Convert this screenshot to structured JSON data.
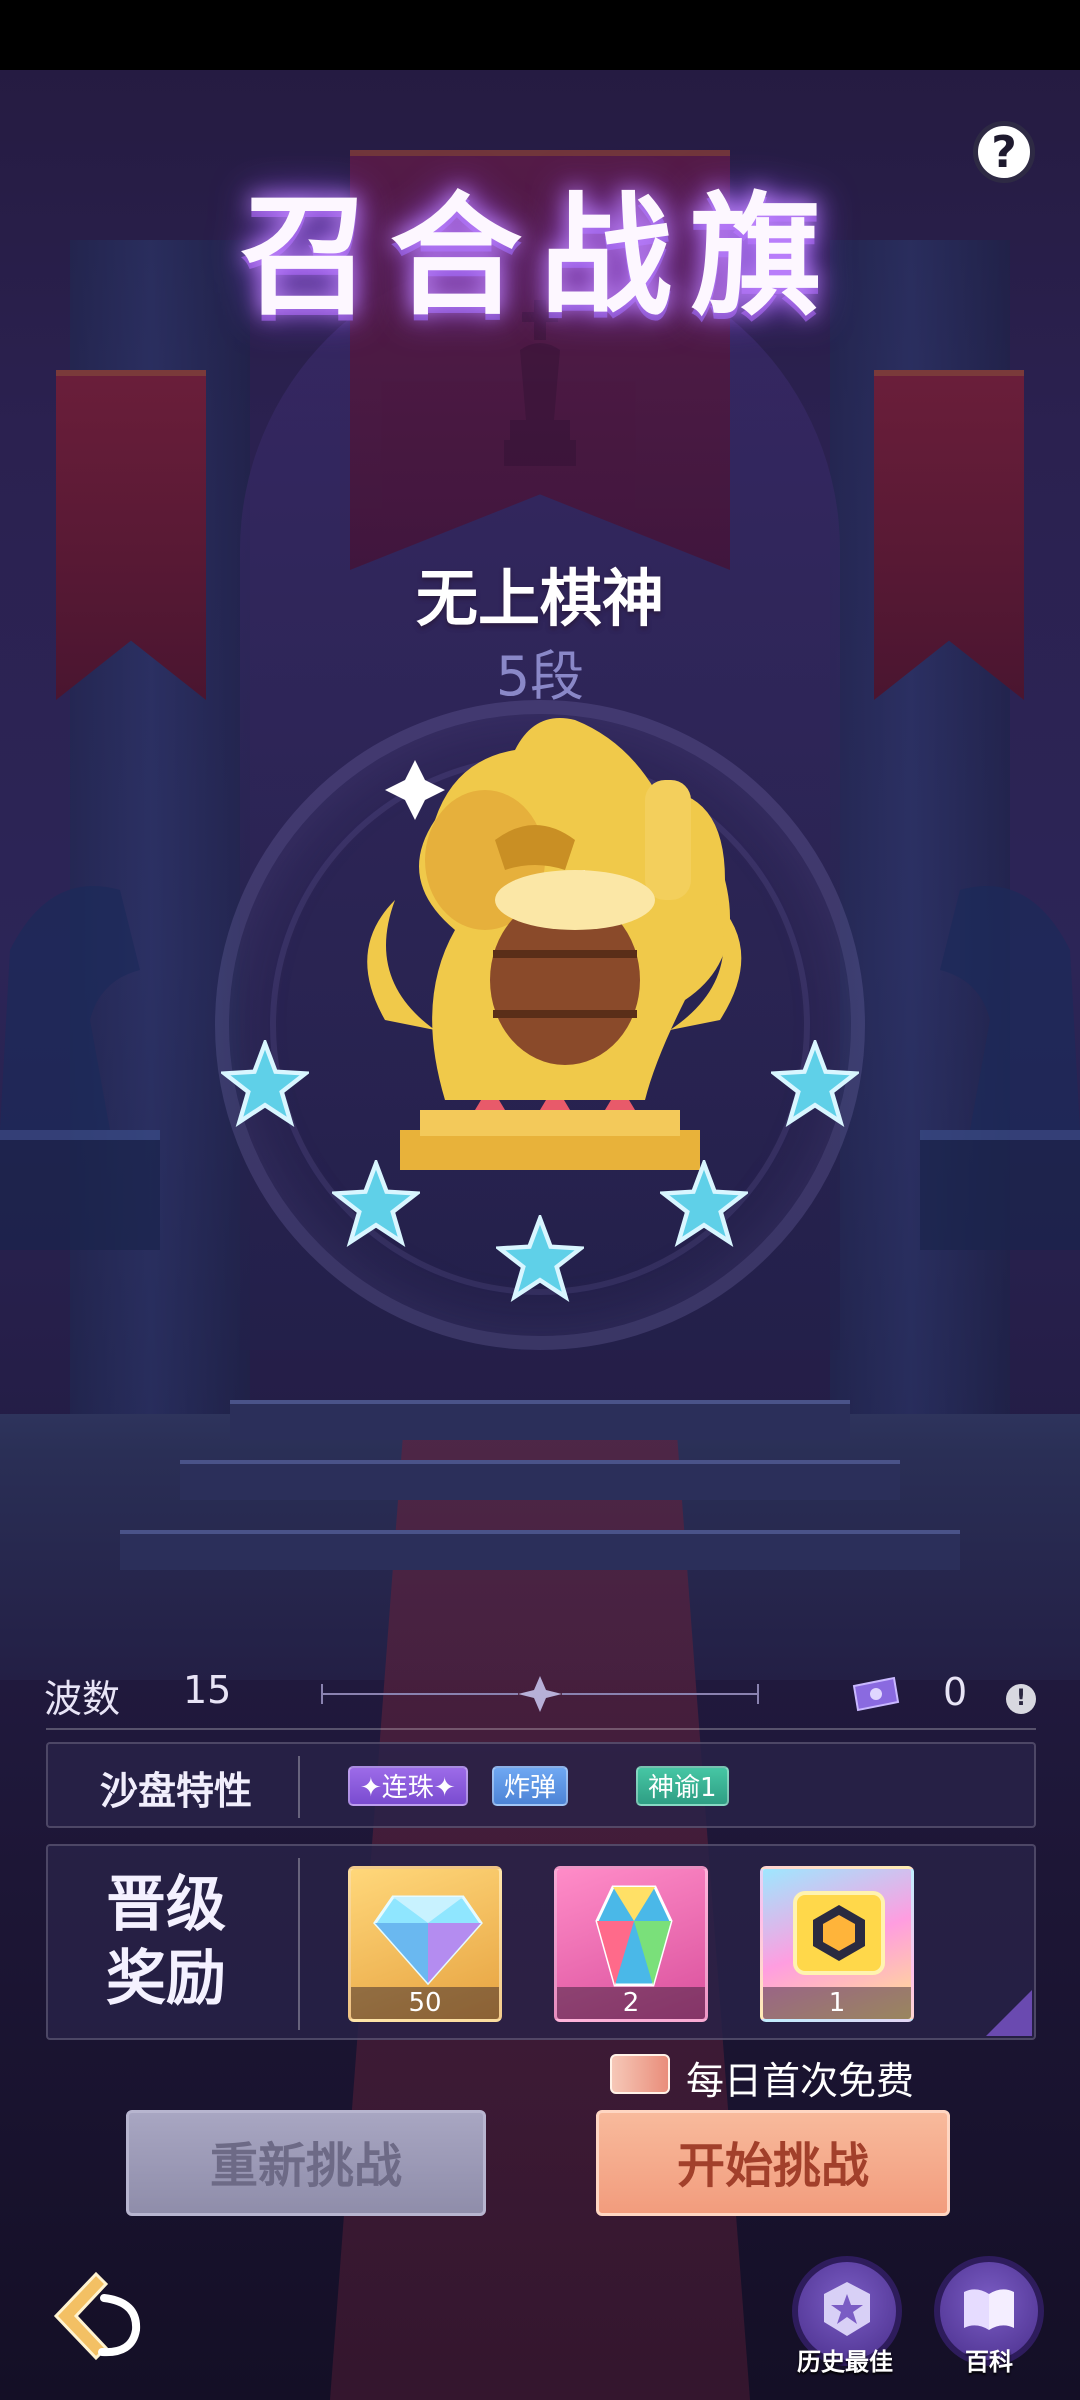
{
  "title": "召合战旗",
  "help_icon": "?",
  "rank": {
    "name": "无上棋神",
    "level": "5段",
    "stars_filled": 5,
    "stars_total": 5
  },
  "stats": {
    "wave_label": "波数",
    "wave_value": "15",
    "ticket_count": "0",
    "info_icon": "!"
  },
  "sandbox": {
    "label": "沙盘特性",
    "tags": [
      "✦连珠✦",
      "炸弹",
      "神谕1"
    ]
  },
  "rewards": {
    "label_line1": "晋级",
    "label_line2": "奖励",
    "items": [
      {
        "icon": "diamond-icon",
        "count": "50"
      },
      {
        "icon": "crystal-icon",
        "count": "2"
      },
      {
        "icon": "hex-chest-icon",
        "count": "1"
      }
    ]
  },
  "free_notice": "每日首次免费",
  "buttons": {
    "retry": "重新挑战",
    "start": "开始挑战"
  },
  "bottom_nav": {
    "best": "历史最佳",
    "wiki": "百科"
  },
  "colors": {
    "background": "#2b2150",
    "title_glow": "#c58cff",
    "start_button": "#f29c7d",
    "retry_button": "#9a98b6",
    "star": "#5fd0e8"
  }
}
